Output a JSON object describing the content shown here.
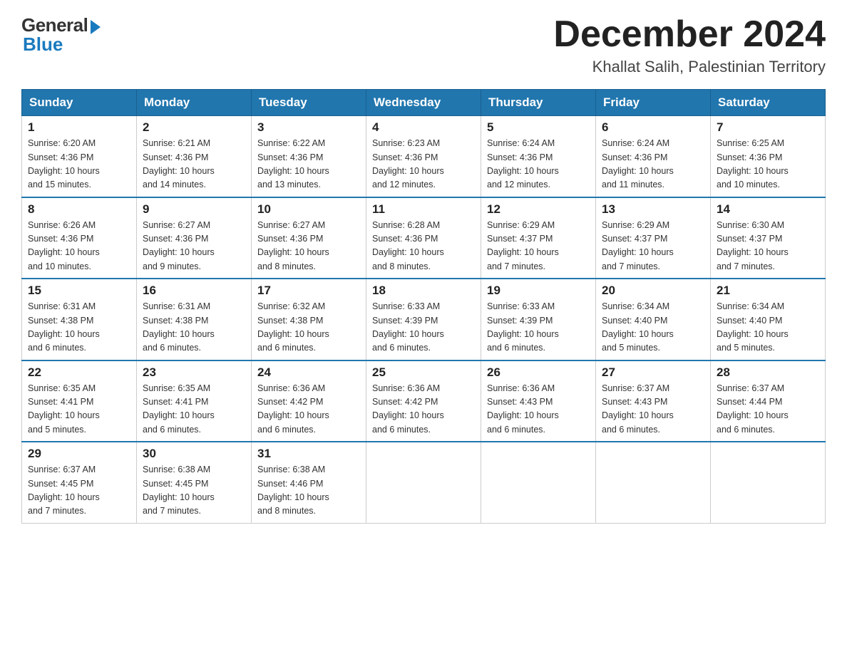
{
  "logo": {
    "general": "General",
    "blue": "Blue"
  },
  "header": {
    "title": "December 2024",
    "subtitle": "Khallat Salih, Palestinian Territory"
  },
  "weekdays": [
    "Sunday",
    "Monday",
    "Tuesday",
    "Wednesday",
    "Thursday",
    "Friday",
    "Saturday"
  ],
  "weeks": [
    [
      {
        "day": "1",
        "sunrise": "6:20 AM",
        "sunset": "4:36 PM",
        "daylight": "10 hours and 15 minutes."
      },
      {
        "day": "2",
        "sunrise": "6:21 AM",
        "sunset": "4:36 PM",
        "daylight": "10 hours and 14 minutes."
      },
      {
        "day": "3",
        "sunrise": "6:22 AM",
        "sunset": "4:36 PM",
        "daylight": "10 hours and 13 minutes."
      },
      {
        "day": "4",
        "sunrise": "6:23 AM",
        "sunset": "4:36 PM",
        "daylight": "10 hours and 12 minutes."
      },
      {
        "day": "5",
        "sunrise": "6:24 AM",
        "sunset": "4:36 PM",
        "daylight": "10 hours and 12 minutes."
      },
      {
        "day": "6",
        "sunrise": "6:24 AM",
        "sunset": "4:36 PM",
        "daylight": "10 hours and 11 minutes."
      },
      {
        "day": "7",
        "sunrise": "6:25 AM",
        "sunset": "4:36 PM",
        "daylight": "10 hours and 10 minutes."
      }
    ],
    [
      {
        "day": "8",
        "sunrise": "6:26 AM",
        "sunset": "4:36 PM",
        "daylight": "10 hours and 10 minutes."
      },
      {
        "day": "9",
        "sunrise": "6:27 AM",
        "sunset": "4:36 PM",
        "daylight": "10 hours and 9 minutes."
      },
      {
        "day": "10",
        "sunrise": "6:27 AM",
        "sunset": "4:36 PM",
        "daylight": "10 hours and 8 minutes."
      },
      {
        "day": "11",
        "sunrise": "6:28 AM",
        "sunset": "4:36 PM",
        "daylight": "10 hours and 8 minutes."
      },
      {
        "day": "12",
        "sunrise": "6:29 AM",
        "sunset": "4:37 PM",
        "daylight": "10 hours and 7 minutes."
      },
      {
        "day": "13",
        "sunrise": "6:29 AM",
        "sunset": "4:37 PM",
        "daylight": "10 hours and 7 minutes."
      },
      {
        "day": "14",
        "sunrise": "6:30 AM",
        "sunset": "4:37 PM",
        "daylight": "10 hours and 7 minutes."
      }
    ],
    [
      {
        "day": "15",
        "sunrise": "6:31 AM",
        "sunset": "4:38 PM",
        "daylight": "10 hours and 6 minutes."
      },
      {
        "day": "16",
        "sunrise": "6:31 AM",
        "sunset": "4:38 PM",
        "daylight": "10 hours and 6 minutes."
      },
      {
        "day": "17",
        "sunrise": "6:32 AM",
        "sunset": "4:38 PM",
        "daylight": "10 hours and 6 minutes."
      },
      {
        "day": "18",
        "sunrise": "6:33 AM",
        "sunset": "4:39 PM",
        "daylight": "10 hours and 6 minutes."
      },
      {
        "day": "19",
        "sunrise": "6:33 AM",
        "sunset": "4:39 PM",
        "daylight": "10 hours and 6 minutes."
      },
      {
        "day": "20",
        "sunrise": "6:34 AM",
        "sunset": "4:40 PM",
        "daylight": "10 hours and 5 minutes."
      },
      {
        "day": "21",
        "sunrise": "6:34 AM",
        "sunset": "4:40 PM",
        "daylight": "10 hours and 5 minutes."
      }
    ],
    [
      {
        "day": "22",
        "sunrise": "6:35 AM",
        "sunset": "4:41 PM",
        "daylight": "10 hours and 5 minutes."
      },
      {
        "day": "23",
        "sunrise": "6:35 AM",
        "sunset": "4:41 PM",
        "daylight": "10 hours and 6 minutes."
      },
      {
        "day": "24",
        "sunrise": "6:36 AM",
        "sunset": "4:42 PM",
        "daylight": "10 hours and 6 minutes."
      },
      {
        "day": "25",
        "sunrise": "6:36 AM",
        "sunset": "4:42 PM",
        "daylight": "10 hours and 6 minutes."
      },
      {
        "day": "26",
        "sunrise": "6:36 AM",
        "sunset": "4:43 PM",
        "daylight": "10 hours and 6 minutes."
      },
      {
        "day": "27",
        "sunrise": "6:37 AM",
        "sunset": "4:43 PM",
        "daylight": "10 hours and 6 minutes."
      },
      {
        "day": "28",
        "sunrise": "6:37 AM",
        "sunset": "4:44 PM",
        "daylight": "10 hours and 6 minutes."
      }
    ],
    [
      {
        "day": "29",
        "sunrise": "6:37 AM",
        "sunset": "4:45 PM",
        "daylight": "10 hours and 7 minutes."
      },
      {
        "day": "30",
        "sunrise": "6:38 AM",
        "sunset": "4:45 PM",
        "daylight": "10 hours and 7 minutes."
      },
      {
        "day": "31",
        "sunrise": "6:38 AM",
        "sunset": "4:46 PM",
        "daylight": "10 hours and 8 minutes."
      },
      null,
      null,
      null,
      null
    ]
  ],
  "labels": {
    "sunrise": "Sunrise:",
    "sunset": "Sunset:",
    "daylight": "Daylight:"
  }
}
